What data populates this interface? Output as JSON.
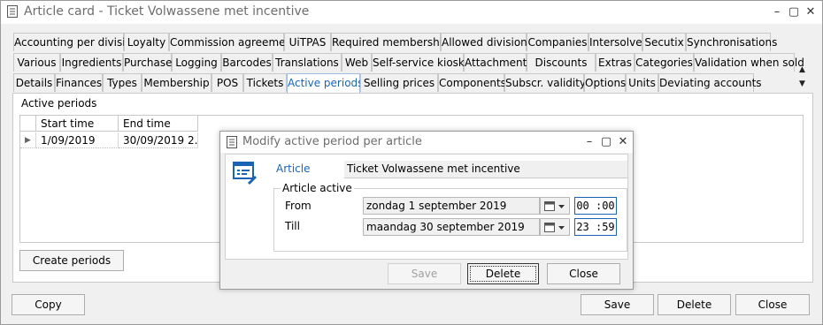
{
  "window": {
    "title": "Article card - Ticket Volwassene met incentive"
  },
  "tabs": {
    "row1": [
      "Accounting per division",
      "Loyalty",
      "Commission agreement",
      "UiTPAS",
      "Required membership",
      "Allowed divisions",
      "Companies",
      "Intersolve",
      "Secutix",
      "Synchronisations"
    ],
    "row2": [
      "Various",
      "Ingredients",
      "Purchase",
      "Logging",
      "Barcodes",
      "Translations",
      "Web",
      "Self-service kiosk",
      "Attachments",
      "Discounts",
      "Extras",
      "Categories",
      "Validation when sold"
    ],
    "row3": [
      "Details",
      "Finances",
      "Types",
      "Membership",
      "POS",
      "Tickets",
      "Active periods",
      "Selling prices",
      "Components",
      "Subscr. validity",
      "Options",
      "Units",
      "Deviating accounts"
    ],
    "active": "Active periods"
  },
  "active_periods": {
    "group_label": "Active periods",
    "columns": [
      "Start time",
      "End time"
    ],
    "rows": [
      [
        "1/09/2019",
        "30/09/2019 2..."
      ]
    ],
    "create_button": "Create periods"
  },
  "footer": {
    "copy": "Copy",
    "save": "Save",
    "delete": "Delete",
    "close": "Close"
  },
  "dialog": {
    "title": "Modify active period per article",
    "article_label": "Article",
    "article_value": "Ticket Volwassene met incentive",
    "group_label": "Article active",
    "from_label": "From",
    "from_date": "zondag 1 september 2019",
    "from_time": "00 :00",
    "till_label": "Till",
    "till_date": "maandag 30 september 2019",
    "till_time": "23 :59",
    "save": "Save",
    "delete": "Delete",
    "close": "Close",
    "accent_color": "#1a64b8"
  }
}
